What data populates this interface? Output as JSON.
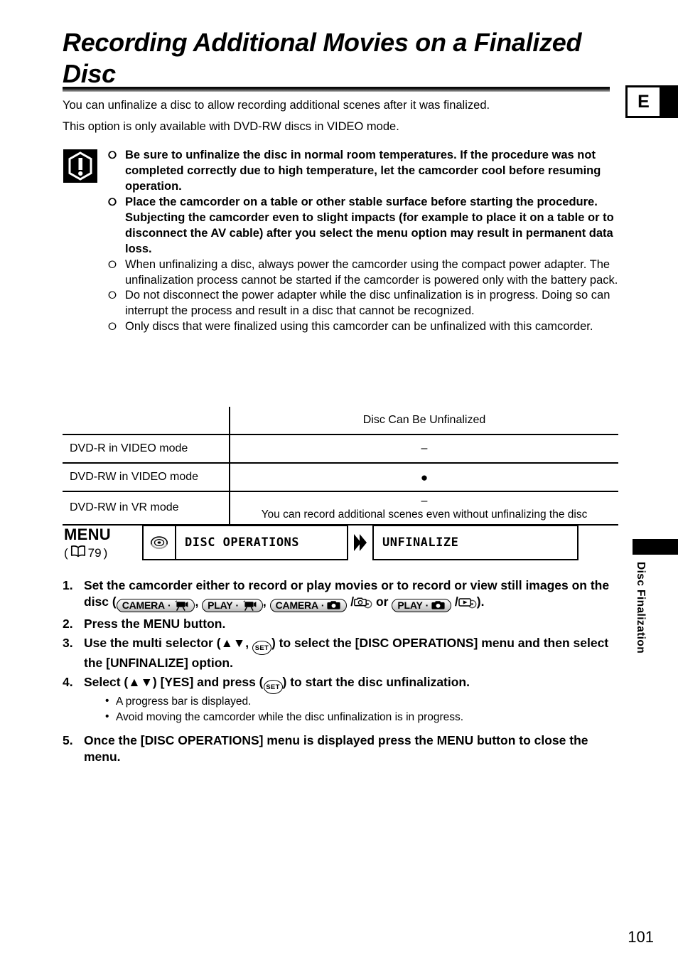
{
  "document": {
    "title": "Recording Additional Movies on a Finalized Disc",
    "page_number": "101",
    "edition_tab": "E",
    "side_tab_label": "Disc Finalization"
  },
  "intro": {
    "line1": "You can unfinalize a disc to allow recording additional scenes after it was finalized.",
    "line2": "This option is only available with DVD-RW discs in VIDEO mode."
  },
  "warning": {
    "icon": "exclamation-warning-icon",
    "bullet_glyph": "⭘",
    "items": [
      {
        "bold": true,
        "text": "Be sure to unfinalize the disc in normal room temperatures. If the procedure was not completed correctly due to high temperature, let the camcorder cool before resuming operation."
      },
      {
        "bold": true,
        "text": "Place the camcorder on a table or other stable surface before starting the procedure. Subjecting the camcorder even to slight impacts (for example to place it on a table or to disconnect the AV cable) after you select the menu option may result in permanent data loss."
      },
      {
        "bold": false,
        "text": "When unfinalizing a disc, always power the camcorder using the compact power adapter. The unfinalization process cannot be started if the camcorder is powered only with the battery pack."
      },
      {
        "bold": false,
        "text": "Do not disconnect the power adapter while the disc unfinalization is in progress. Doing so can interrupt the process and result in a disc that cannot be recognized."
      },
      {
        "bold": false,
        "text": "Only discs that were finalized using this camcorder can be unfinalized with this camcorder."
      }
    ]
  },
  "table": {
    "header_value": "Disc Can Be Unfinalized",
    "rows": [
      {
        "label": "DVD-R in VIDEO mode",
        "value": "–",
        "note": ""
      },
      {
        "label": "DVD-RW in VIDEO mode",
        "value": "●",
        "note": ""
      },
      {
        "label": "DVD-RW in VR mode",
        "value": "–",
        "note": "You can record additional scenes even without unfinalizing the disc"
      }
    ]
  },
  "menu": {
    "label": "MENU",
    "ref_open": "(",
    "ref_page": "79",
    "ref_close": ")",
    "book_icon": "book-icon",
    "disc_icon": "disc-icon",
    "first_box": "DISC OPERATIONS",
    "arrow_icon": "double-chevron-right-icon",
    "second_box": "UNFINALIZE"
  },
  "steps": [
    {
      "num": "1.",
      "parts": [
        {
          "type": "text",
          "value": "Set the camcorder either to record or play movies or to record or view still images on the disc ("
        },
        {
          "type": "badge",
          "label": "CAMERA",
          "icon": "movie-camera-icon"
        },
        {
          "type": "text",
          "value": ", "
        },
        {
          "type": "badge",
          "label": "PLAY",
          "icon": "movie-camera-icon"
        },
        {
          "type": "text",
          "value": ", "
        },
        {
          "type": "badge",
          "label": "CAMERA",
          "icon": "still-camera-icon"
        },
        {
          "type": "text",
          "value": " /"
        },
        {
          "type": "minicon",
          "icon": "camera-card-icon"
        },
        {
          "type": "text",
          "value": " or "
        },
        {
          "type": "badge",
          "label": "PLAY",
          "icon": "still-camera-icon"
        },
        {
          "type": "text",
          "value": " /"
        },
        {
          "type": "minicon",
          "icon": "play-card-icon"
        },
        {
          "type": "text",
          "value": ")."
        }
      ]
    },
    {
      "num": "2.",
      "text": "Press the MENU button."
    },
    {
      "num": "3.",
      "before": "Use the multi selector (",
      "updown": "▲▼",
      "mid": ", ",
      "setkey": "SET",
      "after": ") to select the [DISC OPERATIONS] menu and then select the [UNFINALIZE] option."
    },
    {
      "num": "4.",
      "before": "Select (",
      "updown": "▲▼",
      "mid": ") [YES] and press (",
      "setkey": "SET",
      "after": ") to start the disc unfinalization.",
      "substeps": [
        {
          "bullet": "•",
          "text": "A progress bar is displayed."
        },
        {
          "bullet": "•",
          "text": "Avoid moving the camcorder while the disc unfinalization is in progress."
        }
      ]
    },
    {
      "num": "5.",
      "text": "Once the [DISC OPERATIONS] menu is displayed press the MENU button to close the menu."
    }
  ],
  "colors": {
    "text": "#000000",
    "background": "#ffffff",
    "rule_top": "#000000",
    "rule_bottom": "#b5b5b5"
  }
}
